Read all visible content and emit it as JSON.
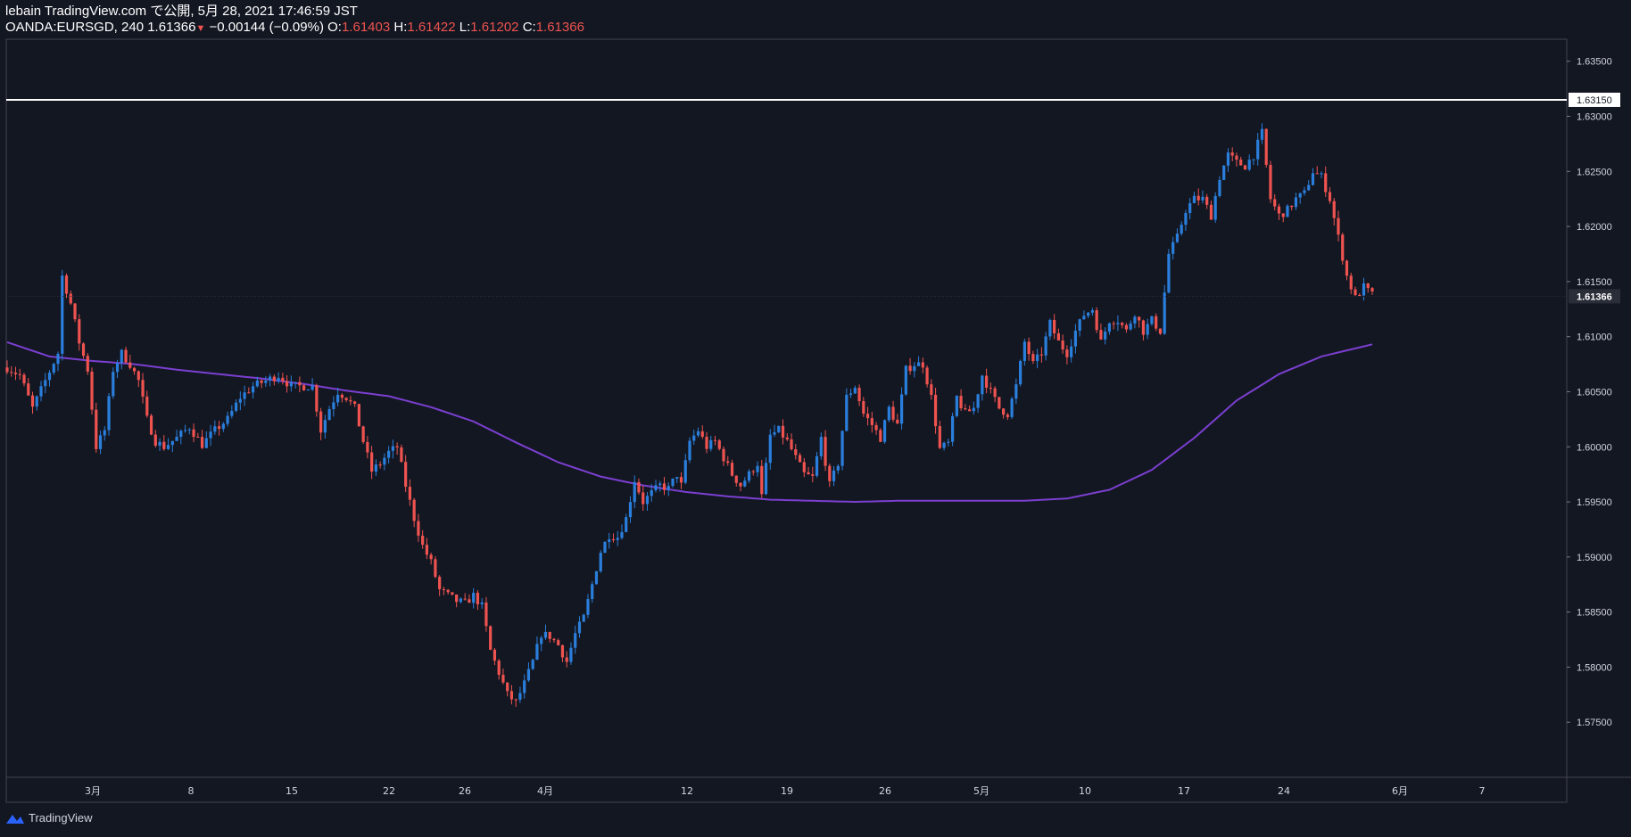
{
  "header": {
    "publisher": "lebain TradingView.com で公開, 5月 28, 2021 17:46:59 JST",
    "symbol": "OANDA:EURSGD, 240",
    "last": "1.61366",
    "change": "−0.00144 (−0.09%)",
    "o_label": "O:",
    "o_value": "1.61403",
    "h_label": "H:",
    "h_value": "1.61422",
    "l_label": "L:",
    "l_value": "1.61202",
    "c_label": "C:",
    "c_value": "1.61366"
  },
  "footer": {
    "brand": "TradingView"
  },
  "colors": {
    "background": "#131722",
    "up": "#2a7fdc",
    "down": "#ef5350",
    "ma": "#7b3fd0",
    "hline": "#ffffff",
    "axis_text": "#d1d4dc"
  },
  "chart_data": {
    "type": "candlestick",
    "title": "",
    "ylim": [
      1.57,
      1.637
    ],
    "y_ticks": [
      "1.63500",
      "1.63000",
      "1.62500",
      "1.62000",
      "1.61500",
      "1.61000",
      "1.60500",
      "1.60000",
      "1.59500",
      "1.59000",
      "1.58500",
      "1.58000",
      "1.57500"
    ],
    "x_ticks": [
      "3月",
      "8",
      "15",
      "22",
      "26",
      "4月",
      "12",
      "19",
      "26",
      "5月",
      "10",
      "17",
      "24",
      "6月",
      "7"
    ],
    "horizontal_line": {
      "value": 1.6315,
      "label": "1.63150"
    },
    "last_price": {
      "value": 1.61366,
      "label": "1.61366"
    },
    "price_path": [
      [
        0,
        1.6072
      ],
      [
        3,
        1.6065
      ],
      [
        6,
        1.6035
      ],
      [
        9,
        1.606
      ],
      [
        12,
        1.6085
      ],
      [
        13,
        1.6155
      ],
      [
        15,
        1.613
      ],
      [
        17,
        1.6095
      ],
      [
        19,
        1.607
      ],
      [
        21,
        1.6
      ],
      [
        23,
        1.6015
      ],
      [
        25,
        1.607
      ],
      [
        27,
        1.6085
      ],
      [
        29,
        1.6075
      ],
      [
        31,
        1.606
      ],
      [
        33,
        1.6025
      ],
      [
        35,
        1.6005
      ],
      [
        37,
        1.6
      ],
      [
        40,
        1.6008
      ],
      [
        43,
        1.6018
      ],
      [
        46,
        1.6002
      ],
      [
        49,
        1.6015
      ],
      [
        52,
        1.6025
      ],
      [
        55,
        1.6045
      ],
      [
        58,
        1.6055
      ],
      [
        61,
        1.606
      ],
      [
        64,
        1.6065
      ],
      [
        67,
        1.6055
      ],
      [
        70,
        1.6055
      ],
      [
        72,
        1.6055
      ],
      [
        74,
        1.6015
      ],
      [
        76,
        1.6035
      ],
      [
        78,
        1.605
      ],
      [
        80,
        1.6045
      ],
      [
        82,
        1.6035
      ],
      [
        84,
        1.6005
      ],
      [
        86,
        1.5978
      ],
      [
        88,
        1.5985
      ],
      [
        90,
        1.5995
      ],
      [
        92,
        1.6
      ],
      [
        94,
        1.5965
      ],
      [
        96,
        1.5935
      ],
      [
        98,
        1.591
      ],
      [
        100,
        1.5895
      ],
      [
        102,
        1.587
      ],
      [
        104,
        1.5865
      ],
      [
        106,
        1.586
      ],
      [
        108,
        1.5858
      ],
      [
        110,
        1.5865
      ],
      [
        112,
        1.5855
      ],
      [
        114,
        1.5815
      ],
      [
        116,
        1.5795
      ],
      [
        118,
        1.5775
      ],
      [
        120,
        1.5768
      ],
      [
        122,
        1.5785
      ],
      [
        124,
        1.5805
      ],
      [
        126,
        1.583
      ],
      [
        128,
        1.5828
      ],
      [
        130,
        1.582
      ],
      [
        132,
        1.5805
      ],
      [
        134,
        1.583
      ],
      [
        136,
        1.5845
      ],
      [
        138,
        1.5875
      ],
      [
        140,
        1.5905
      ],
      [
        142,
        1.592
      ],
      [
        144,
        1.5918
      ],
      [
        146,
        1.5935
      ],
      [
        148,
        1.597
      ],
      [
        150,
        1.595
      ],
      [
        152,
        1.5958
      ],
      [
        154,
        1.5965
      ],
      [
        156,
        1.5962
      ],
      [
        158,
        1.5975
      ],
      [
        159,
        1.5965
      ],
      [
        161,
        1.6005
      ],
      [
        163,
        1.6015
      ],
      [
        165,
        1.6
      ],
      [
        167,
        1.6005
      ],
      [
        169,
        1.599
      ],
      [
        171,
        1.5975
      ],
      [
        173,
        1.5965
      ],
      [
        175,
        1.5975
      ],
      [
        177,
        1.5985
      ],
      [
        178,
        1.5955
      ],
      [
        180,
        1.601
      ],
      [
        182,
        1.6015
      ],
      [
        184,
        1.6005
      ],
      [
        186,
        1.599
      ],
      [
        188,
        1.5975
      ],
      [
        190,
        1.5972
      ],
      [
        192,
        1.6008
      ],
      [
        194,
        1.5965
      ],
      [
        196,
        1.5985
      ],
      [
        198,
        1.6045
      ],
      [
        200,
        1.6055
      ],
      [
        202,
        1.603
      ],
      [
        204,
        1.602
      ],
      [
        206,
        1.6008
      ],
      [
        208,
        1.6035
      ],
      [
        210,
        1.602
      ],
      [
        212,
        1.607
      ],
      [
        214,
        1.6075
      ],
      [
        216,
        1.6075
      ],
      [
        218,
        1.6045
      ],
      [
        220,
        1.5998
      ],
      [
        222,
        1.6003
      ],
      [
        224,
        1.6045
      ],
      [
        226,
        1.603
      ],
      [
        228,
        1.6035
      ],
      [
        230,
        1.6065
      ],
      [
        232,
        1.605
      ],
      [
        234,
        1.6035
      ],
      [
        236,
        1.603
      ],
      [
        238,
        1.6055
      ],
      [
        240,
        1.6095
      ],
      [
        242,
        1.6075
      ],
      [
        244,
        1.6085
      ],
      [
        246,
        1.6112
      ],
      [
        248,
        1.6095
      ],
      [
        250,
        1.6085
      ],
      [
        252,
        1.6105
      ],
      [
        254,
        1.612
      ],
      [
        256,
        1.6125
      ],
      [
        258,
        1.6095
      ],
      [
        260,
        1.6115
      ],
      [
        262,
        1.6115
      ],
      [
        264,
        1.6105
      ],
      [
        266,
        1.6122
      ],
      [
        268,
        1.6105
      ],
      [
        270,
        1.6115
      ],
      [
        272,
        1.6105
      ],
      [
        274,
        1.6175
      ],
      [
        276,
        1.619
      ],
      [
        278,
        1.6215
      ],
      [
        280,
        1.6225
      ],
      [
        282,
        1.6225
      ],
      [
        284,
        1.621
      ],
      [
        286,
        1.6245
      ],
      [
        288,
        1.6265
      ],
      [
        290,
        1.6258
      ],
      [
        292,
        1.6255
      ],
      [
        294,
        1.6265
      ],
      [
        296,
        1.6285
      ],
      [
        298,
        1.6225
      ],
      [
        300,
        1.621
      ],
      [
        302,
        1.6215
      ],
      [
        304,
        1.6225
      ],
      [
        306,
        1.623
      ],
      [
        308,
        1.625
      ],
      [
        310,
        1.6245
      ],
      [
        312,
        1.6225
      ],
      [
        314,
        1.619
      ],
      [
        316,
        1.6155
      ],
      [
        318,
        1.6135
      ],
      [
        320,
        1.6145
      ],
      [
        322,
        1.6138
      ]
    ],
    "ma_path": [
      [
        0,
        1.6095
      ],
      [
        10,
        1.6082
      ],
      [
        20,
        1.6078
      ],
      [
        30,
        1.6075
      ],
      [
        40,
        1.607
      ],
      [
        50,
        1.6066
      ],
      [
        60,
        1.6062
      ],
      [
        70,
        1.6057
      ],
      [
        80,
        1.6051
      ],
      [
        90,
        1.6046
      ],
      [
        100,
        1.6036
      ],
      [
        110,
        1.6023
      ],
      [
        120,
        1.6004
      ],
      [
        130,
        1.5986
      ],
      [
        140,
        1.5973
      ],
      [
        150,
        1.5965
      ],
      [
        160,
        1.5959
      ],
      [
        170,
        1.5955
      ],
      [
        180,
        1.5952
      ],
      [
        190,
        1.5951
      ],
      [
        200,
        1.595
      ],
      [
        210,
        1.5951
      ],
      [
        220,
        1.5951
      ],
      [
        230,
        1.5951
      ],
      [
        240,
        1.5951
      ],
      [
        250,
        1.5953
      ],
      [
        260,
        1.5961
      ],
      [
        270,
        1.5979
      ],
      [
        280,
        1.6008
      ],
      [
        290,
        1.6042
      ],
      [
        300,
        1.6066
      ],
      [
        310,
        1.6082
      ],
      [
        322,
        1.6093
      ]
    ]
  }
}
